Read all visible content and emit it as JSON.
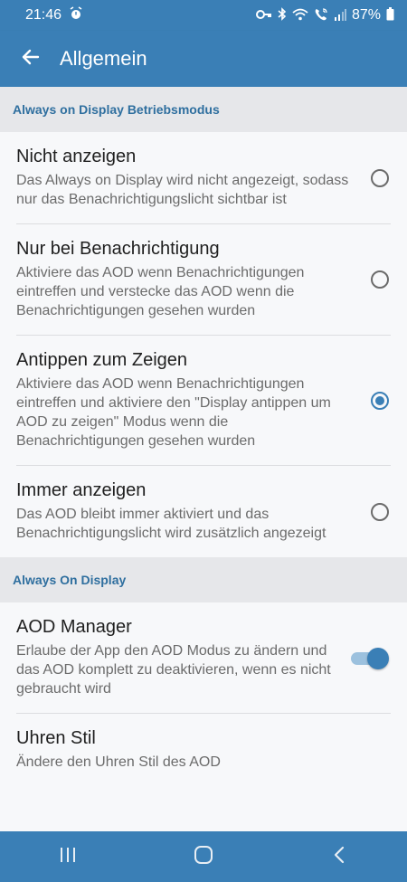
{
  "status_bar": {
    "time": "21:46",
    "battery": "87%"
  },
  "app_bar": {
    "title": "Allgemein"
  },
  "sections": [
    {
      "header": "Always on Display Betriebsmodus",
      "options": [
        {
          "title": "Nicht anzeigen",
          "desc": "Das Always on Display wird nicht angezeigt, sodass nur das Benachrichtigungslicht sichtbar ist",
          "checked": false
        },
        {
          "title": "Nur bei Benachrichtigung",
          "desc": "Aktiviere das AOD wenn Benachrichtigungen eintreffen und verstecke das AOD wenn die Benachrichtigungen gesehen wurden",
          "checked": false
        },
        {
          "title": "Antippen zum Zeigen",
          "desc": "Aktiviere das AOD wenn Benachrichtigungen eintreffen und aktiviere den \"Display antippen um AOD zu zeigen\" Modus wenn die Benachrichtigungen gesehen wurden",
          "checked": true
        },
        {
          "title": "Immer anzeigen",
          "desc": "Das AOD bleibt immer aktiviert und das Benachrichtigungslicht wird zusätzlich angezeigt",
          "checked": false
        }
      ]
    },
    {
      "header": "Always On Display",
      "items": [
        {
          "title": "AOD Manager",
          "desc": "Erlaube der App den AOD Modus zu ändern und das AOD komplett zu deaktivieren, wenn es nicht gebraucht wird",
          "switch_on": true
        },
        {
          "title": "Uhren Stil",
          "desc": "Ändere den Uhren Stil des AOD"
        }
      ]
    }
  ],
  "colors": {
    "primary": "#3a7fb6",
    "section_header_text": "#2f6f9f",
    "section_header_bg": "#e6e7ea"
  },
  "icons": {
    "back": "arrow-left-icon",
    "alarm": "alarm-icon",
    "key": "key-icon",
    "bluetooth": "bluetooth-icon",
    "wifi": "wifi-icon",
    "call": "wifi-call-icon",
    "signal": "signal-icon",
    "battery": "battery-icon",
    "recents": "recents-icon",
    "home": "home-icon",
    "nav_back": "nav-back-icon"
  }
}
